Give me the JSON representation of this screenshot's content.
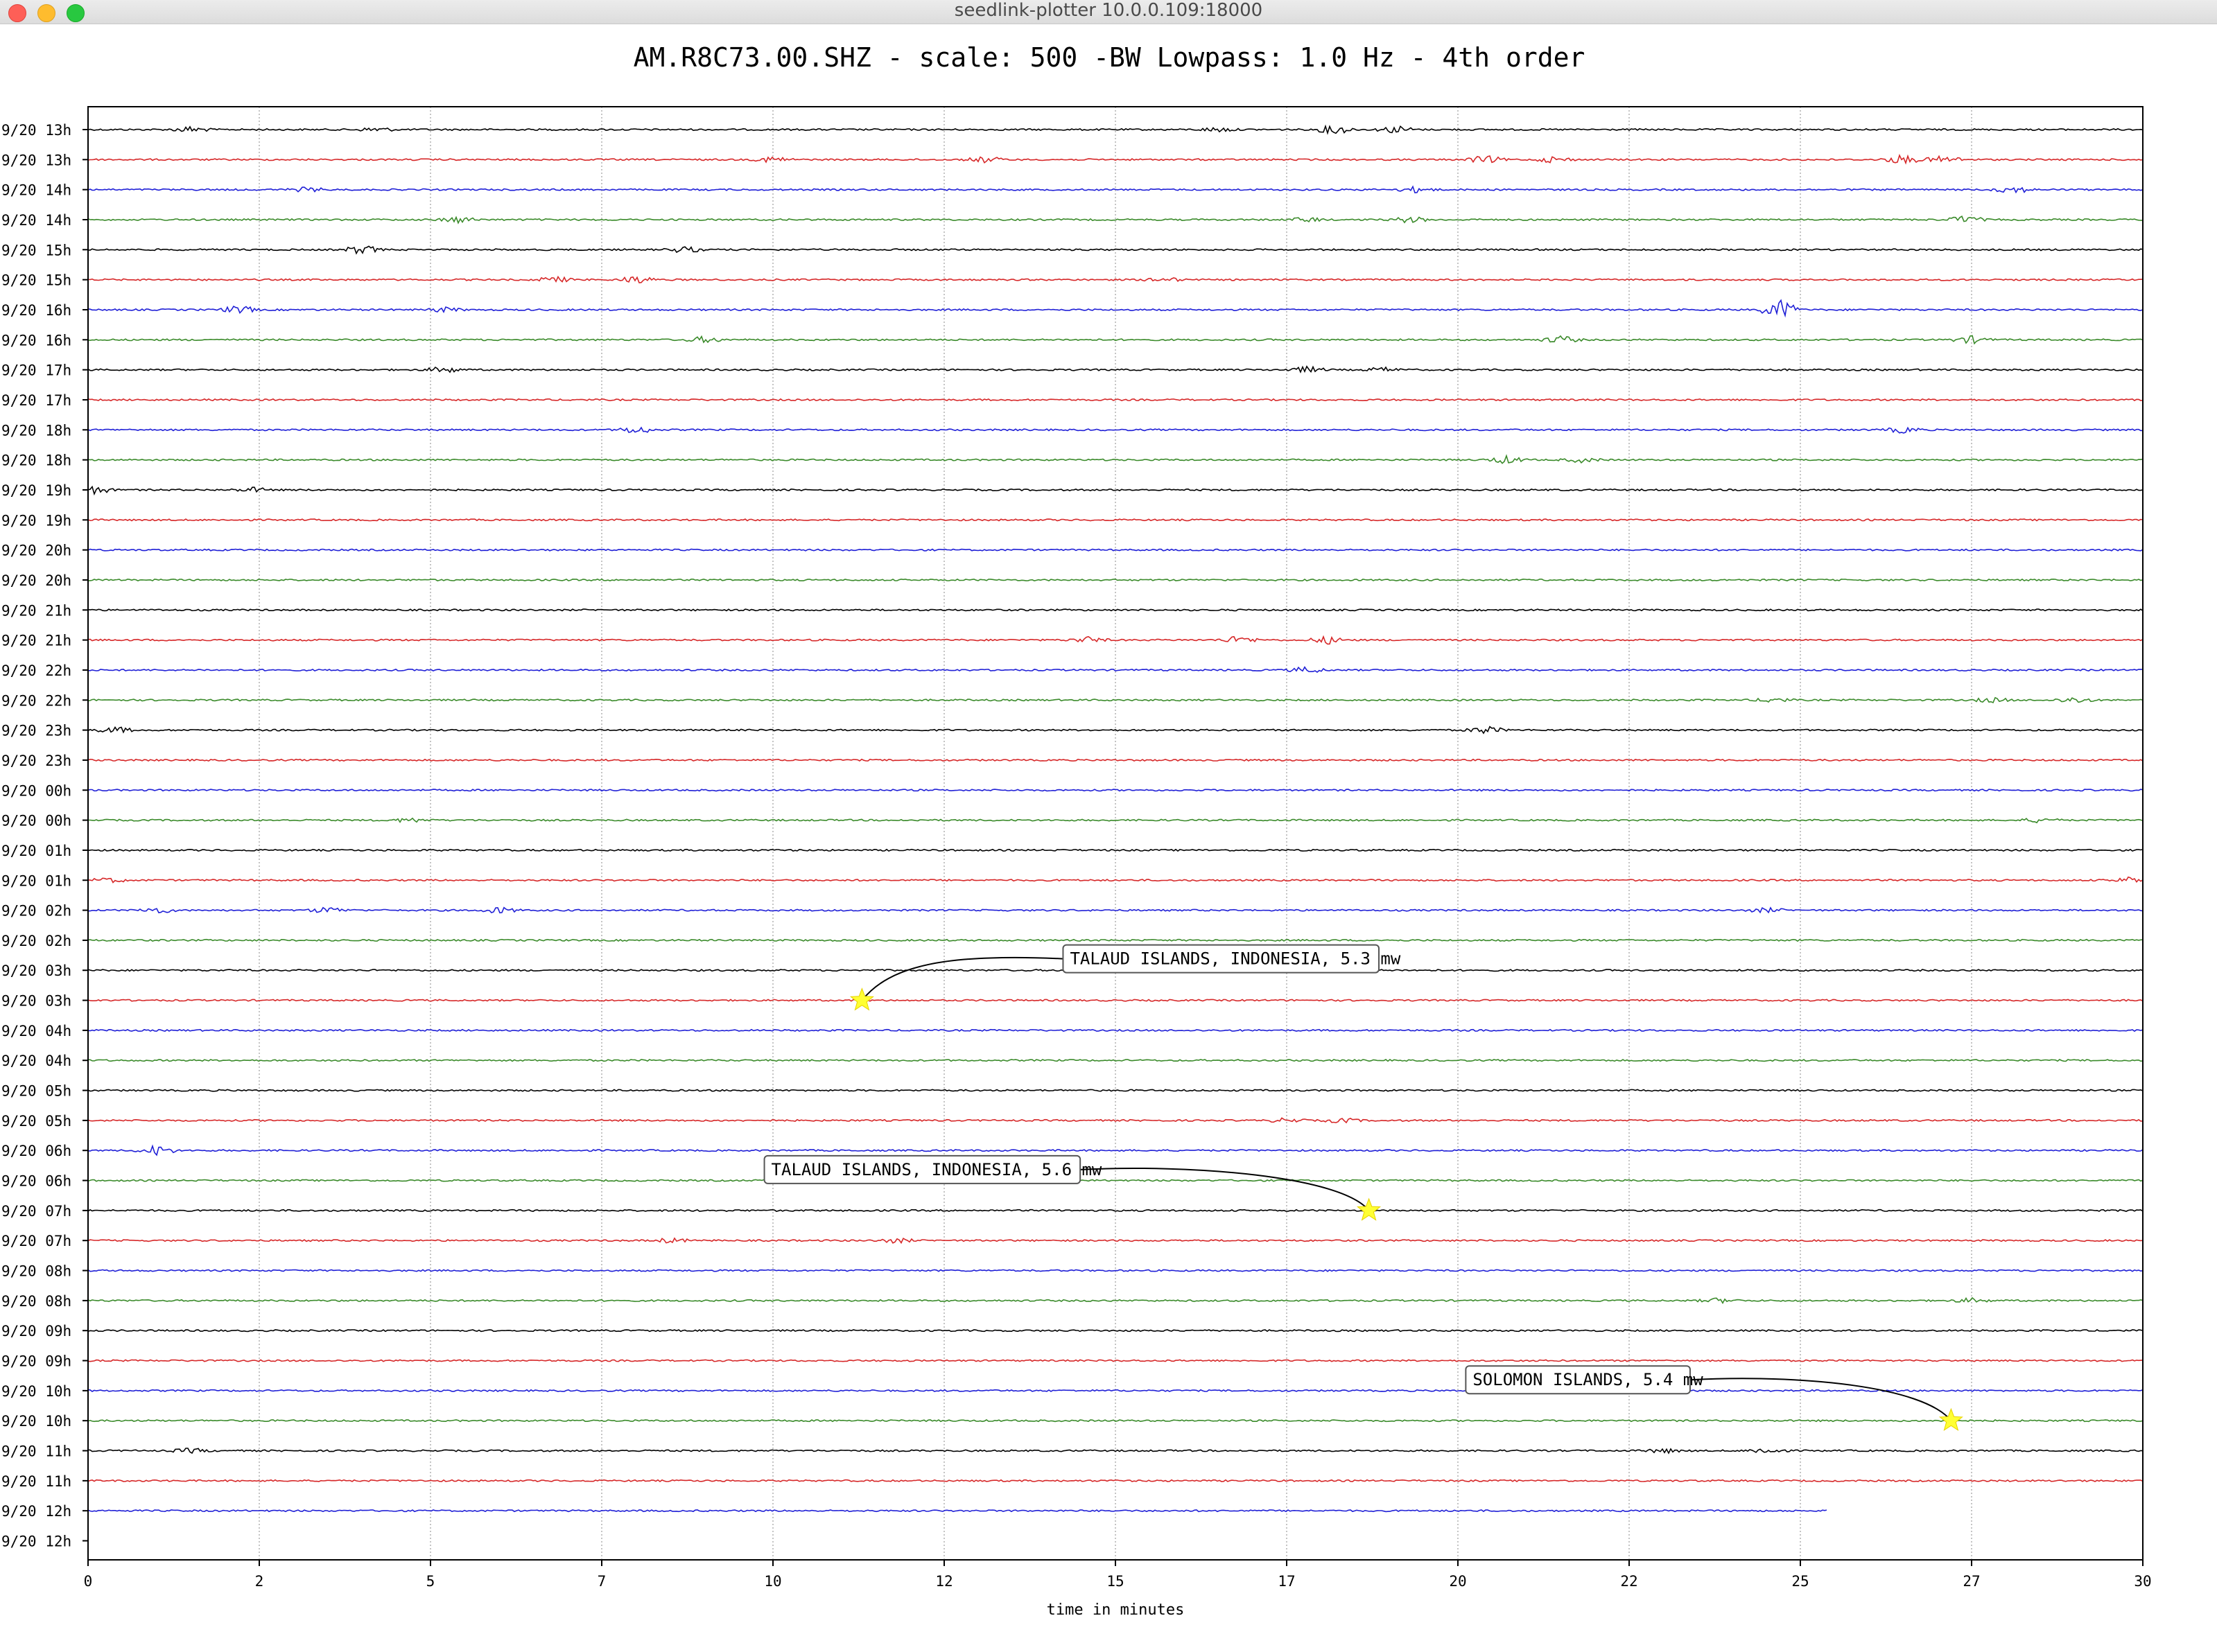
{
  "window": {
    "title": "seedlink-plotter 10.0.0.109:18000"
  },
  "colors": {
    "trace_cycle": [
      "#000000",
      "#d62728",
      "#1f1fd6",
      "#3a8a2a"
    ],
    "star": "#ffff33",
    "grid": "#b0b0b0"
  },
  "chart_data": {
    "type": "line",
    "title": "AM.R8C73.00.SHZ - scale: 500 -BW Lowpass: 1.0 Hz - 4th order",
    "xlabel": "time in minutes",
    "ylabel": "",
    "xlim": [
      0,
      30
    ],
    "x_ticks": [
      {
        "value": 0,
        "label": "0"
      },
      {
        "value": 2.5,
        "label": "2"
      },
      {
        "value": 5,
        "label": "5"
      },
      {
        "value": 7.5,
        "label": "7"
      },
      {
        "value": 10,
        "label": "10"
      },
      {
        "value": 12.5,
        "label": "12"
      },
      {
        "value": 15,
        "label": "15"
      },
      {
        "value": 17.5,
        "label": "17"
      },
      {
        "value": 20,
        "label": "20"
      },
      {
        "value": 22.5,
        "label": "22"
      },
      {
        "value": 25,
        "label": "25"
      },
      {
        "value": 27.5,
        "label": "27"
      },
      {
        "value": 30,
        "label": "30"
      }
    ],
    "grid": "vertical",
    "row_labels": [
      "9/20 13h",
      "9/20 13h",
      "9/20 14h",
      "9/20 14h",
      "9/20 15h",
      "9/20 15h",
      "9/20 16h",
      "9/20 16h",
      "9/20 17h",
      "9/20 17h",
      "9/20 18h",
      "9/20 18h",
      "9/20 19h",
      "9/20 19h",
      "9/20 20h",
      "9/20 20h",
      "9/20 21h",
      "9/20 21h",
      "9/20 22h",
      "9/20 22h",
      "9/20 23h",
      "9/20 23h",
      "9/20 00h",
      "9/20 00h",
      "9/20 01h",
      "9/20 01h",
      "9/20 02h",
      "9/20 02h",
      "9/20 03h",
      "9/20 03h",
      "9/20 04h",
      "9/20 04h",
      "9/20 05h",
      "9/20 05h",
      "9/20 06h",
      "9/20 06h",
      "9/20 07h",
      "9/20 07h",
      "9/20 08h",
      "9/20 08h",
      "9/20 09h",
      "9/20 09h",
      "9/20 10h",
      "9/20 10h",
      "9/20 11h",
      "9/20 11h",
      "9/20 12h",
      "9/20 12h"
    ],
    "last_trace_end_minutes": 25.4,
    "events": [
      {
        "row": 29,
        "minute": 11.3,
        "label": "TALAUD ISLANDS, INDONESIA, 5.3 mw",
        "box_side": "upper-right"
      },
      {
        "row": 36,
        "minute": 18.7,
        "label": "TALAUD ISLANDS, INDONESIA, 5.6 mw",
        "box_side": "upper-left"
      },
      {
        "row": 43,
        "minute": 27.2,
        "label": "SOLOMON ISLANDS, 5.4 mw",
        "box_side": "upper-left"
      }
    ],
    "bursts": [
      {
        "row": 0,
        "minute": 1.5,
        "amp": 4
      },
      {
        "row": 0,
        "minute": 4.2,
        "amp": 3
      },
      {
        "row": 0,
        "minute": 16.5,
        "amp": 3
      },
      {
        "row": 0,
        "minute": 18.2,
        "amp": 6
      },
      {
        "row": 0,
        "minute": 19.1,
        "amp": 5
      },
      {
        "row": 1,
        "minute": 10,
        "amp": 4
      },
      {
        "row": 1,
        "minute": 13.1,
        "amp": 4
      },
      {
        "row": 1,
        "minute": 20.4,
        "amp": 5
      },
      {
        "row": 1,
        "minute": 21.4,
        "amp": 4
      },
      {
        "row": 1,
        "minute": 26.5,
        "amp": 6
      },
      {
        "row": 1,
        "minute": 27.1,
        "amp": 5
      },
      {
        "row": 2,
        "minute": 3.2,
        "amp": 3
      },
      {
        "row": 2,
        "minute": 19.4,
        "amp": 4
      },
      {
        "row": 2,
        "minute": 28.1,
        "amp": 5
      },
      {
        "row": 3,
        "minute": 5.4,
        "amp": 4
      },
      {
        "row": 3,
        "minute": 17.8,
        "amp": 3
      },
      {
        "row": 3,
        "minute": 19.3,
        "amp": 4
      },
      {
        "row": 3,
        "minute": 27.4,
        "amp": 5
      },
      {
        "row": 4,
        "minute": 4,
        "amp": 6
      },
      {
        "row": 4,
        "minute": 8.7,
        "amp": 4
      },
      {
        "row": 5,
        "minute": 6.8,
        "amp": 4
      },
      {
        "row": 5,
        "minute": 8,
        "amp": 5
      },
      {
        "row": 5,
        "minute": 15.7,
        "amp": 3
      },
      {
        "row": 6,
        "minute": 2.2,
        "amp": 5
      },
      {
        "row": 6,
        "minute": 5.2,
        "amp": 3
      },
      {
        "row": 6,
        "minute": 24.7,
        "amp": 14
      },
      {
        "row": 7,
        "minute": 9,
        "amp": 4
      },
      {
        "row": 7,
        "minute": 21.5,
        "amp": 5
      },
      {
        "row": 7,
        "minute": 27.5,
        "amp": 5
      },
      {
        "row": 8,
        "minute": 5.2,
        "amp": 4
      },
      {
        "row": 8,
        "minute": 17.8,
        "amp": 4
      },
      {
        "row": 8,
        "minute": 18.9,
        "amp": 3
      },
      {
        "row": 10,
        "minute": 8,
        "amp": 5
      },
      {
        "row": 10,
        "minute": 26.5,
        "amp": 4
      },
      {
        "row": 11,
        "minute": 20.7,
        "amp": 5
      },
      {
        "row": 11,
        "minute": 21.8,
        "amp": 3
      },
      {
        "row": 12,
        "minute": 0.1,
        "amp": 5
      },
      {
        "row": 12,
        "minute": 2.4,
        "amp": 3
      },
      {
        "row": 17,
        "minute": 14.6,
        "amp": 4
      },
      {
        "row": 17,
        "minute": 16.8,
        "amp": 5
      },
      {
        "row": 17,
        "minute": 18.1,
        "amp": 5
      },
      {
        "row": 18,
        "minute": 17.8,
        "amp": 4
      },
      {
        "row": 19,
        "minute": 24.6,
        "amp": 3
      },
      {
        "row": 19,
        "minute": 27.8,
        "amp": 3
      },
      {
        "row": 19,
        "minute": 29,
        "amp": 4
      },
      {
        "row": 20,
        "minute": 0.4,
        "amp": 4
      },
      {
        "row": 20,
        "minute": 20.4,
        "amp": 5
      },
      {
        "row": 23,
        "minute": 4.7,
        "amp": 3
      },
      {
        "row": 23,
        "minute": 28.5,
        "amp": 3
      },
      {
        "row": 25,
        "minute": 0.3,
        "amp": 3
      },
      {
        "row": 25,
        "minute": 29.8,
        "amp": 4
      },
      {
        "row": 26,
        "minute": 1,
        "amp": 4
      },
      {
        "row": 26,
        "minute": 3.5,
        "amp": 4
      },
      {
        "row": 26,
        "minute": 6,
        "amp": 4
      },
      {
        "row": 26,
        "minute": 24.5,
        "amp": 3
      },
      {
        "row": 34,
        "minute": 1,
        "amp": 7
      },
      {
        "row": 33,
        "minute": 17.5,
        "amp": 3
      },
      {
        "row": 33,
        "minute": 18.3,
        "amp": 3
      },
      {
        "row": 37,
        "minute": 8.5,
        "amp": 3
      },
      {
        "row": 37,
        "minute": 11.8,
        "amp": 3
      },
      {
        "row": 39,
        "minute": 23.8,
        "amp": 3
      },
      {
        "row": 39,
        "minute": 27.5,
        "amp": 3
      },
      {
        "row": 44,
        "minute": 1.5,
        "amp": 3
      },
      {
        "row": 44,
        "minute": 23,
        "amp": 3
      },
      {
        "row": 44,
        "minute": 24.5,
        "amp": 4
      }
    ]
  }
}
